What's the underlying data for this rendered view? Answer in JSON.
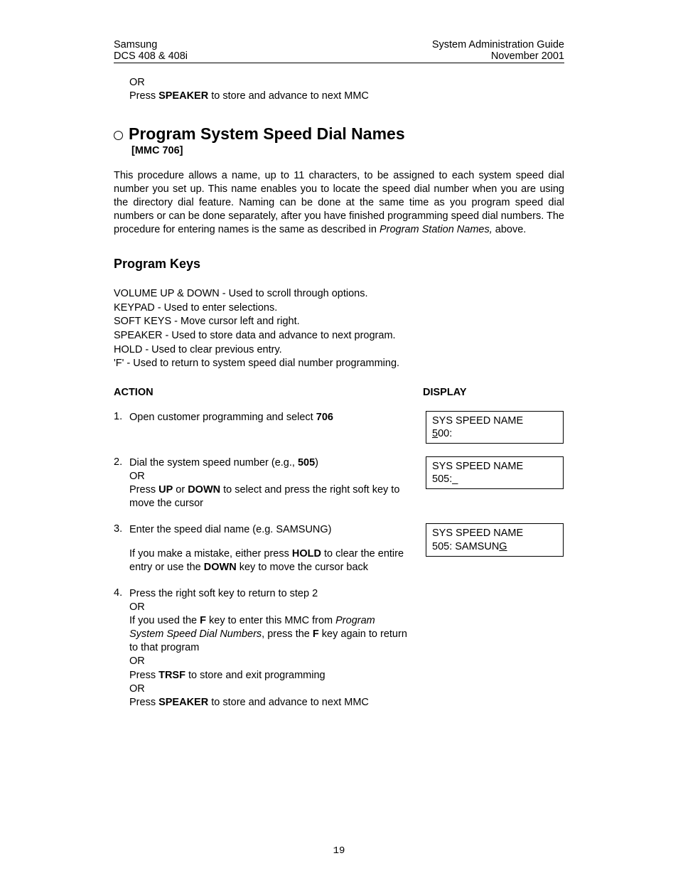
{
  "header": {
    "left1": "Samsung",
    "left2": "DCS 408 & 408i",
    "right1": "System Administration Guide",
    "right2": "November 2001"
  },
  "residual": {
    "or": "OR",
    "press": "Press ",
    "speaker": "SPEAKER",
    "rest": " to store and advance to next MMC"
  },
  "section": {
    "title": "Program System Speed Dial Names",
    "mmc": "[MMC 706]"
  },
  "intro": {
    "p1a": "This procedure allows a name, up to 11 characters, to be assigned to each system speed dial number you set up. This name enables you to locate the speed dial number when you are using the directory dial feature. Naming can be done at the same time as you program speed dial numbers or can be done separately, after you have finished programming speed dial numbers. The procedure for entering names is the same as described in ",
    "p1i": "Program Station Names,",
    "p1b": " above."
  },
  "pkhead": "Program Keys",
  "keys": {
    "k1": "VOLUME UP & DOWN - Used to scroll through options.",
    "k2": "KEYPAD - Used to enter selections.",
    "k3": "SOFT KEYS - Move cursor left and right.",
    "k4": "SPEAKER - Used to store data and advance to next program.",
    "k5": "HOLD - Used to clear previous entry.",
    "k6": "'F' - Used to return to system speed dial number programming."
  },
  "cols": {
    "action": "ACTION",
    "display": "DISPLAY"
  },
  "steps": {
    "s1": {
      "n": "1.",
      "a1": "Open customer programming and select ",
      "a1b": "706",
      "d1": "SYS SPEED NAME",
      "d2a": "5",
      "d2b": "00:"
    },
    "s2": {
      "n": "2.",
      "a1": "Dial the system speed number (e.g., ",
      "a1b": "505",
      "a1c": ")",
      "a2": "OR",
      "a3a": "Press ",
      "a3b": "UP",
      "a3c": " or ",
      "a3d": "DOWN",
      "a3e": " to select and press the right soft key to move the cursor",
      "d1": "SYS SPEED NAME",
      "d2": "505:_"
    },
    "s3": {
      "n": "3.",
      "a1": "Enter the speed dial name (e.g. SAMSUNG)",
      "a2a": "If you make a mistake, either press ",
      "a2b": "HOLD",
      "a2c": " to clear the entire entry or use the ",
      "a2d": "DOWN",
      "a2e": " key to move the cursor back",
      "d1": "SYS SPEED NAME",
      "d2a": "505: SAMSUN",
      "d2b": "G"
    },
    "s4": {
      "n": "4.",
      "a1": "Press the right soft key to return to step 2",
      "a2": "OR",
      "a3a": "If you used the ",
      "a3b": "F",
      "a3c": " key to enter this MMC from ",
      "a3i": "Program System Speed Dial Numbers",
      "a3d": ", press the ",
      "a3e": "F",
      "a3f": " key again to return to that program",
      "a4": "OR",
      "a5a": "Press ",
      "a5b": "TRSF",
      "a5c": " to store and exit programming",
      "a6": "OR",
      "a7a": "Press ",
      "a7b": "SPEAKER",
      "a7c": " to store and advance to next MMC"
    }
  },
  "pagenum": "19"
}
